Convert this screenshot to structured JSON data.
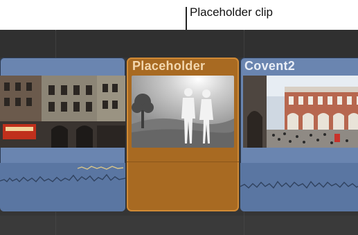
{
  "annotation": {
    "label": "Placeholder clip"
  },
  "timeline": {
    "clips": [
      {
        "title": "",
        "kind": "video"
      },
      {
        "title": "Placeholder",
        "kind": "placeholder"
      },
      {
        "title": "Covent2",
        "kind": "video"
      }
    ]
  },
  "colors": {
    "video_clip": "#6a85b0",
    "placeholder_clip": "#a86a22",
    "timeline_bg": "#353535"
  }
}
